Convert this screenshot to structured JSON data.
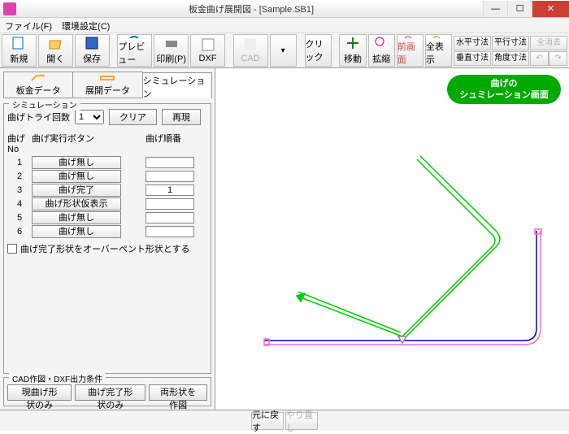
{
  "window": {
    "title": "板金曲げ展開図 - [Sample.SB1]"
  },
  "menu": {
    "file": "ファイル(F)",
    "env": "環境設定(C)"
  },
  "toolbar": {
    "new": "新規",
    "open": "開く",
    "save": "保存",
    "preview": "プレビュー",
    "print": "印刷(P)",
    "dxf": "DXF",
    "cad": "CAD",
    "click": "クリック",
    "move": "移動",
    "zoom": "拡縮",
    "prev": "前画面",
    "all": "全表示"
  },
  "rightbar": {
    "h": "水平寸法",
    "p": "平行寸法",
    "clr": "全消去",
    "v": "垂直寸法",
    "a": "角度寸法",
    "u1": "↶",
    "u2": "↷"
  },
  "tabs": {
    "t1": "板金データ",
    "t2": "展開データ",
    "t3": "シミュレーション"
  },
  "sim": {
    "legend": "シミュレーション",
    "try_label": "曲げトライ回数",
    "try_val": "1",
    "clear": "クリア",
    "replay": "再現",
    "hdr_no": "曲げNo",
    "hdr_btn": "曲げ実行ボタン",
    "hdr_ord": "曲げ順番",
    "rows": [
      {
        "no": "1",
        "btn": "曲げ無し",
        "ord": ""
      },
      {
        "no": "2",
        "btn": "曲げ無し",
        "ord": ""
      },
      {
        "no": "3",
        "btn": "曲げ完了",
        "ord": "1"
      },
      {
        "no": "4",
        "btn": "曲げ形状仮表示",
        "ord": ""
      },
      {
        "no": "5",
        "btn": "曲げ無し",
        "ord": ""
      },
      {
        "no": "6",
        "btn": "曲げ無し",
        "ord": ""
      }
    ],
    "chk_label": "曲げ完了形状をオーバーペント形状とする"
  },
  "cad": {
    "legend": "CAD作図・DXF出力条件",
    "b1": "現曲げ形状のみ",
    "b2": "曲げ完了形状のみ",
    "b3": "両形状を作図"
  },
  "badge": {
    "l1": "曲げの",
    "l2": "シュミレーション画面"
  },
  "bottom": {
    "undo": "元に戻す",
    "redo": "やり直し"
  }
}
